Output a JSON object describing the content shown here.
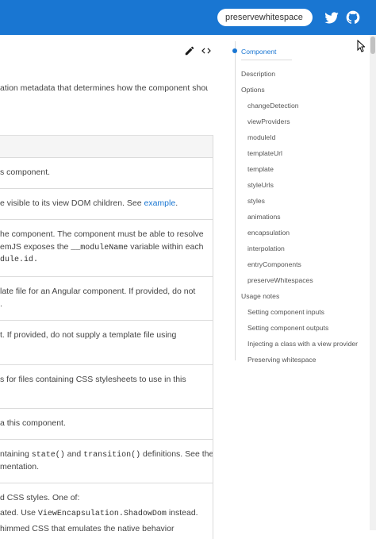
{
  "header": {
    "search_value": "preservewhitespace",
    "twitter_icon": "twitter-icon",
    "github_icon": "github-icon"
  },
  "doc_actions": {
    "edit_icon": "pencil-icon",
    "source_icon": "code-icon"
  },
  "intro": {
    "line1": "ation metadata that determines how the component should"
  },
  "table": {
    "rows": [
      {
        "lines": [
          "s component."
        ]
      },
      {
        "lines": [
          "e visible to its view DOM children. See "
        ],
        "link": "example"
      },
      {
        "lines": [
          "he component. The component must be able to resolve",
          "emJS exposes the ",
          "dule.id."
        ],
        "code": [
          "__moduleName",
          " variable within each"
        ]
      },
      {
        "lines": [
          "late file for an Angular component. If provided, do not",
          "."
        ]
      },
      {
        "lines": [
          "t. If provided, do not supply a template file using"
        ]
      },
      {
        "lines": [
          "s for files containing CSS stylesheets to use in this"
        ]
      },
      {
        "lines": [
          "a this component."
        ]
      },
      {
        "lines": [
          "ntaining ",
          " and ",
          " definitions. See the",
          "mentation."
        ],
        "code": [
          "state()",
          "transition()"
        ]
      },
      {
        "lines": [
          "d CSS styles. One of:",
          "ated. Use ",
          " instead.",
          "himmed CSS that emulates the native behavior"
        ],
        "code": [
          "ViewEncapsulation.ShadowDom"
        ]
      }
    ]
  },
  "toc": {
    "active": "Component",
    "items": [
      "Description",
      "Options",
      "changeDetection",
      "viewProviders",
      "moduleId",
      "templateUrl",
      "template",
      "styleUrls",
      "styles",
      "animations",
      "encapsulation",
      "interpolation",
      "entryComponents",
      "preserveWhitespaces",
      "Usage notes",
      "Setting component inputs",
      "Setting component outputs",
      "Injecting a class with a view provider",
      "Preserving whitespace"
    ]
  },
  "colors": {
    "brand": "#1976d2",
    "link": "#1976d2",
    "divider": "#dbdbdb"
  }
}
